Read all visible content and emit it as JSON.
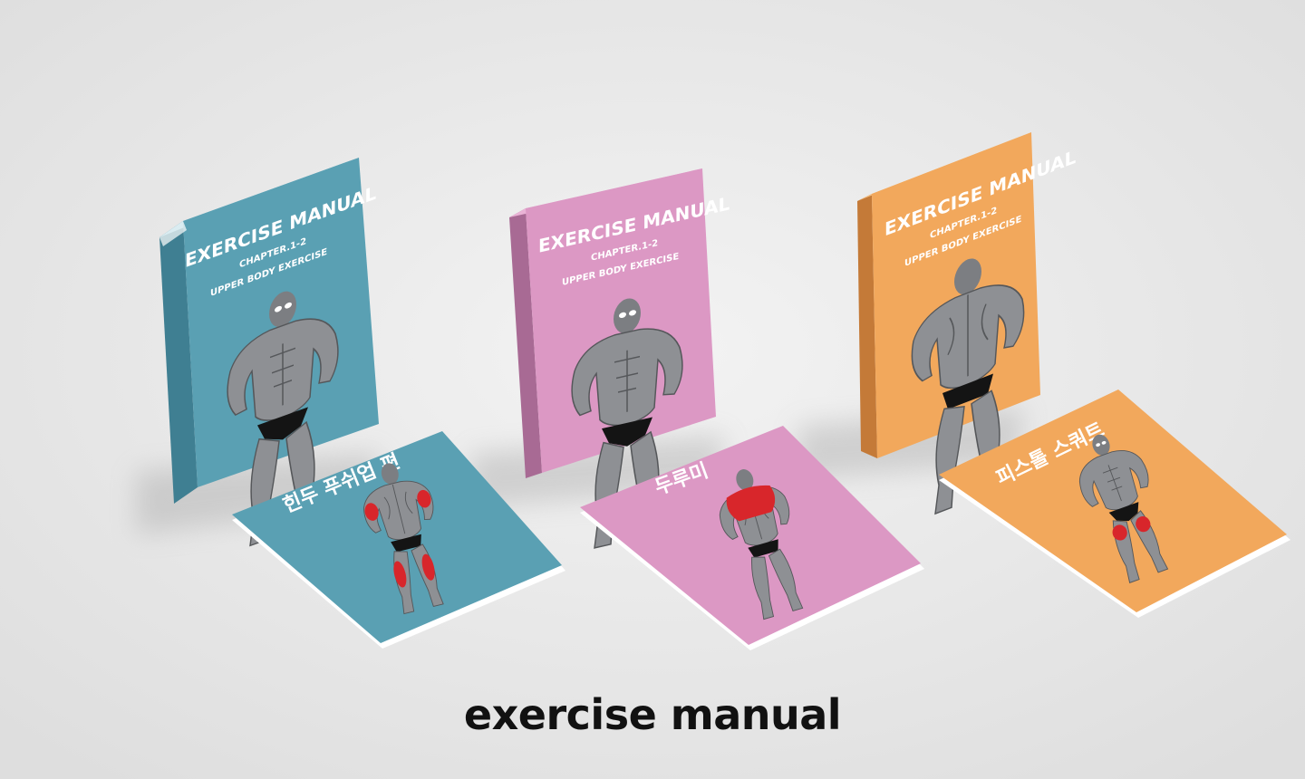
{
  "caption": "exercise manual",
  "colors": {
    "background": "#ececec",
    "teal": "#5aa0b3",
    "pink": "#dc98c4",
    "orange": "#f2a85c",
    "figure_gray": "#8e9094",
    "highlight_red": "#d8262b"
  },
  "boxes": [
    {
      "title": "EXERCISE MANUAL",
      "chapter": "CHAPTER.1-2",
      "subtitle": "UPPER BODY EXERCISE",
      "color": "teal"
    },
    {
      "title": "EXERCISE MANUAL",
      "chapter": "CHAPTER.1-2",
      "subtitle": "UPPER BODY EXERCISE",
      "color": "pink"
    },
    {
      "title": "EXERCISE MANUAL",
      "chapter": "CHAPTER.1-2",
      "subtitle": "UPPER BODY EXERCISE",
      "color": "orange"
    }
  ],
  "booklets": [
    {
      "title": "힌두 푸쉬업 편",
      "color": "teal"
    },
    {
      "title": "두루미",
      "color": "pink"
    },
    {
      "title": "피스톨 스쿼트",
      "color": "orange"
    }
  ]
}
